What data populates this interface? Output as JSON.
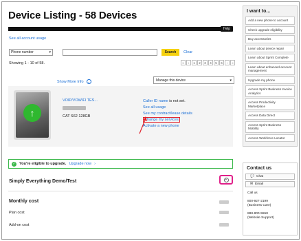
{
  "page_title": "Device Listing - 58 Devices",
  "help_label": "Help",
  "account_usage_link": "See all account usage",
  "search": {
    "filter_value": "Phone number",
    "button": "Search",
    "clear": "Clear"
  },
  "showing_text": "Showing 1 - 10 of 58.",
  "pager": [
    "«",
    "‹",
    "1",
    "2",
    "3",
    "4",
    "5",
    "6",
    "›",
    "»"
  ],
  "show_more_info": "Show More Info",
  "manage_select": "Manage this device",
  "device": {
    "name": "VOIP/VOWIFI TES...",
    "model": "CAT S62 128GB",
    "caller_id_link": "Caller ID name",
    "caller_id_suffix": " is not set.",
    "see_usage": "See all usage",
    "see_contract": "See my contract/lease details",
    "change_services": "Change my services",
    "activate": "Activate a new phone"
  },
  "upgrade_banner": {
    "text": "You're eligible to upgrade.",
    "link": "Upgrade now"
  },
  "plan_name": "Simply Everything Demo/Test",
  "costs": {
    "title": "Monthly cost",
    "plan": "Plan cost",
    "addon": "Add-on cost"
  },
  "sidebar": {
    "heading": "I want to...",
    "items": [
      "Add a new phone to account",
      "Check upgrade eligibility",
      "Buy accessories",
      "Learn about device repair",
      "Learn about Sprint Complete",
      "Learn about enhanced account management",
      "Upgrade my phone",
      "Access Sprint Business Invoice Analytics",
      "Access Productivity Marketplace",
      "Access Data Direct",
      "Access Sprint Business Mobility",
      "Access Workforce Locator"
    ]
  },
  "contact": {
    "heading": "Contact us",
    "chat": "Chat",
    "email": "Email",
    "call_us": "Call us",
    "phone1": "800-927-2199",
    "phone1_note": "(Business Care)",
    "phone2": "888-800-5558",
    "phone2_note": "(Website Support)"
  },
  "colors": {
    "link": "#1a6fd6",
    "search_button": "#f5d10f",
    "upgrade_green": "#3cb94c",
    "highlight_red": "#e0202a",
    "highlight_pink": "#e0208a"
  }
}
